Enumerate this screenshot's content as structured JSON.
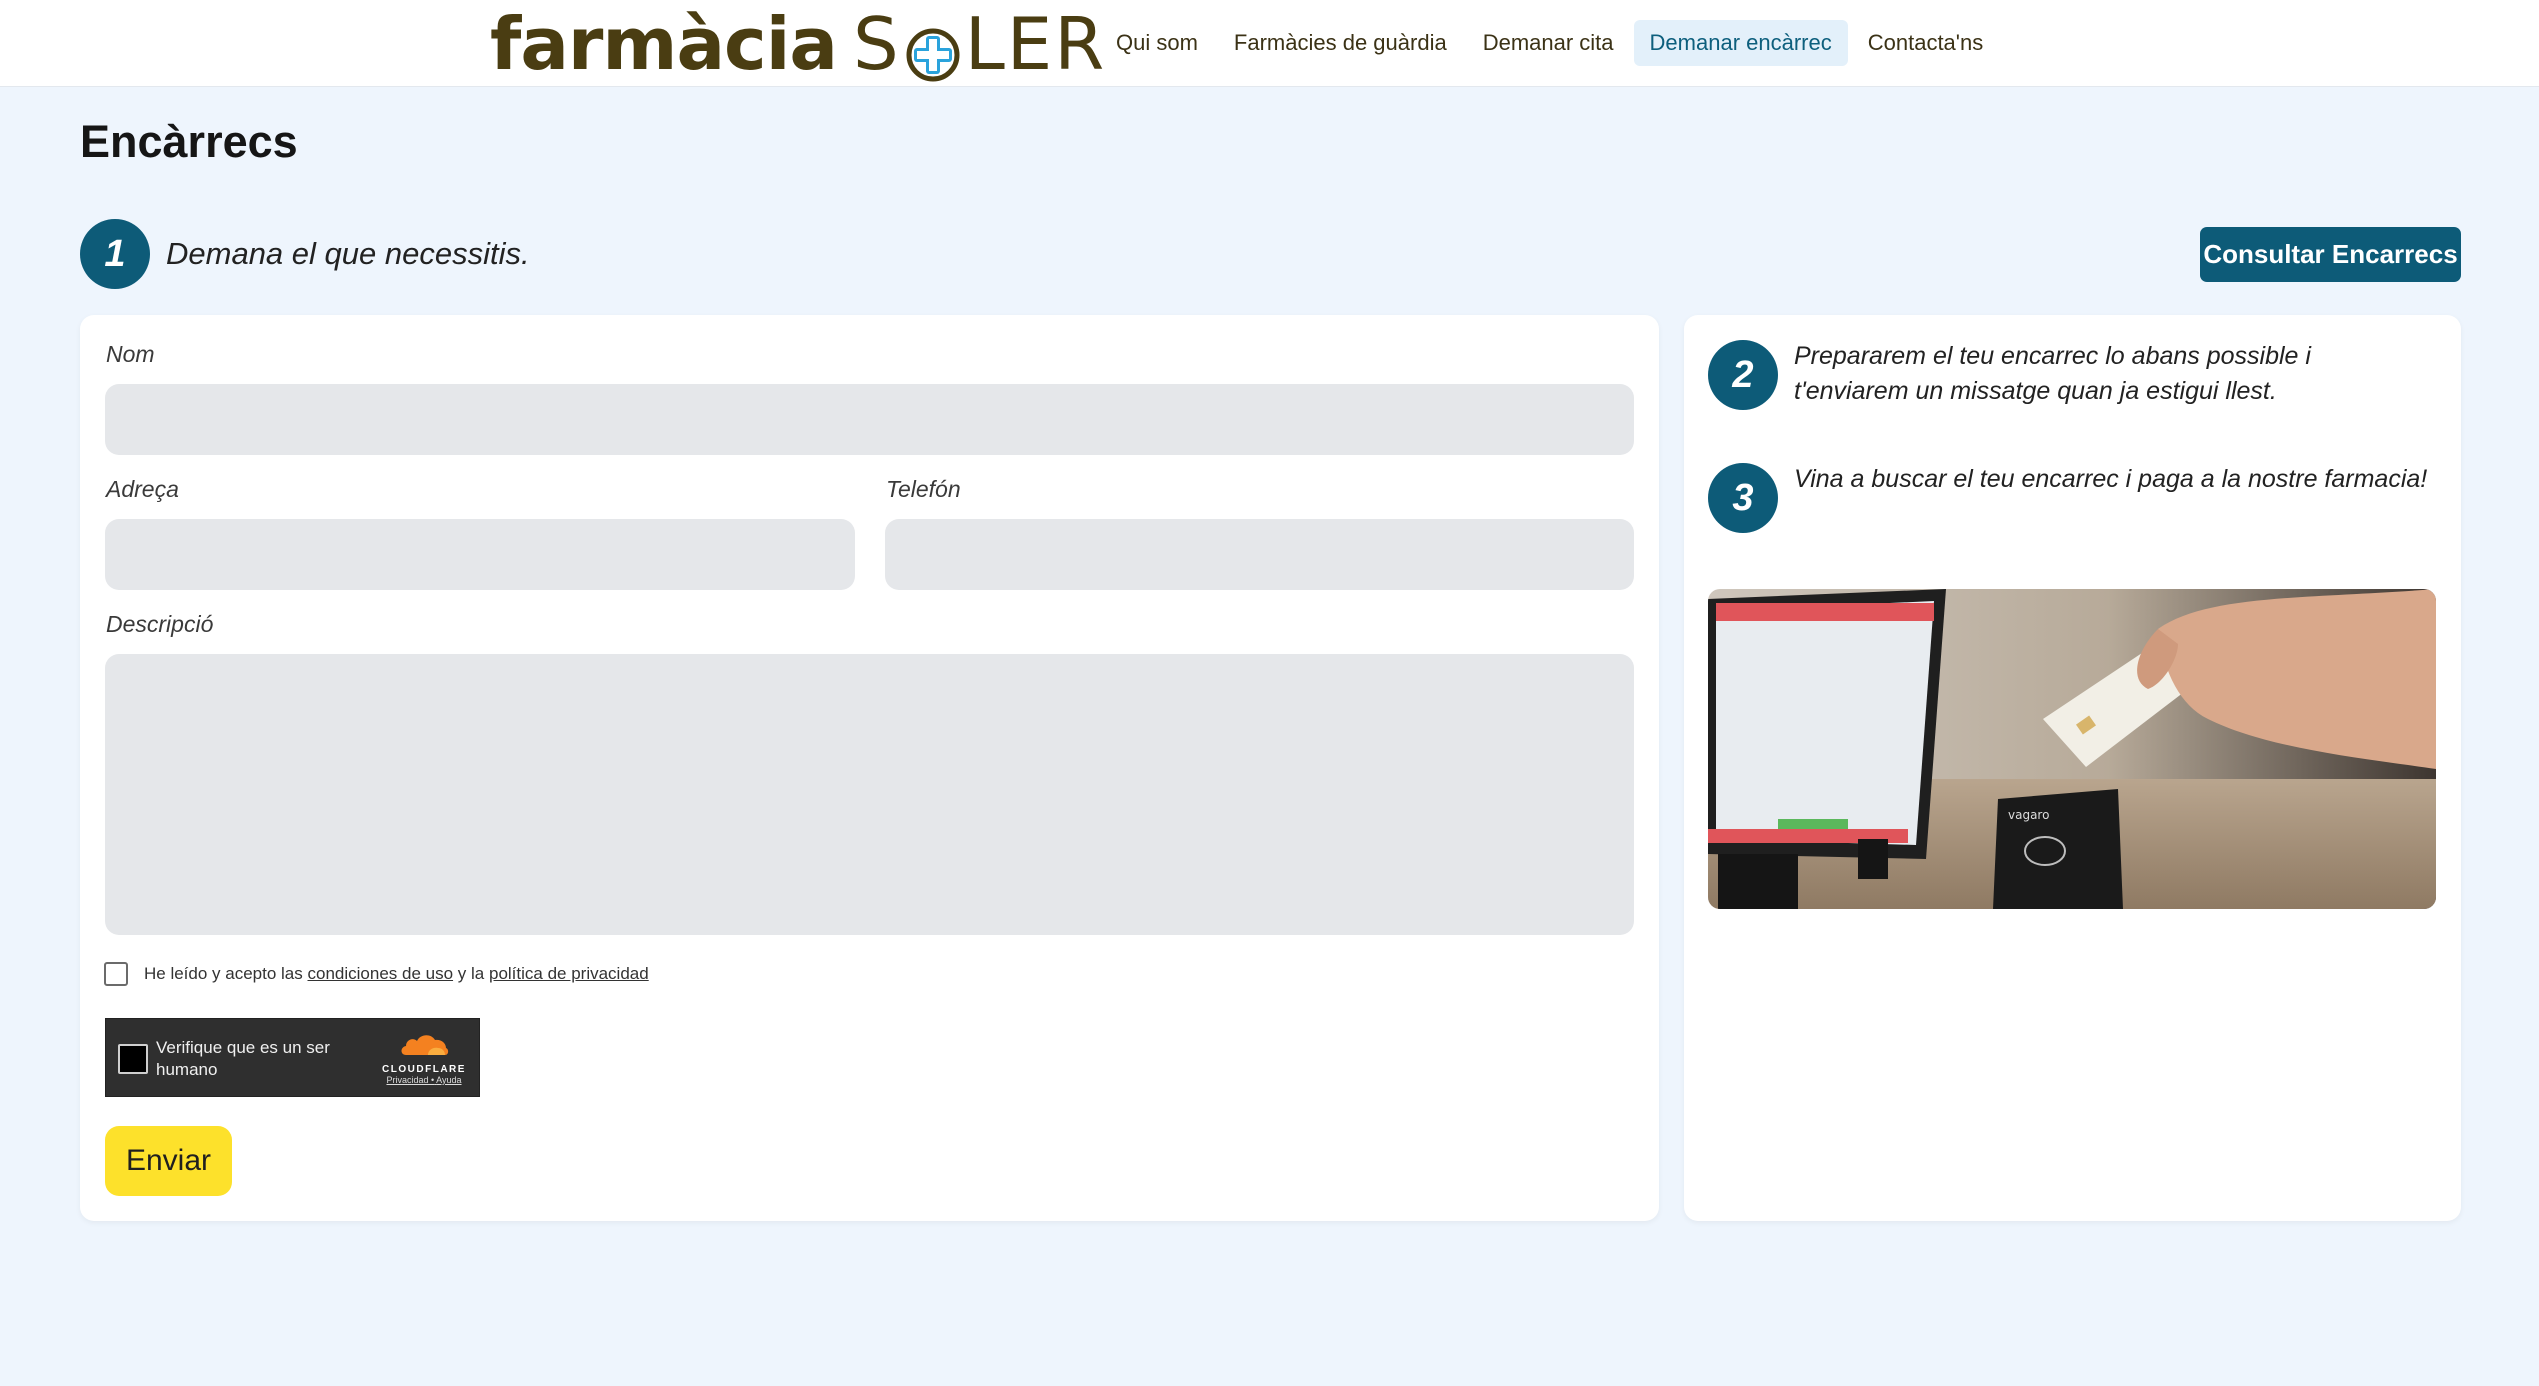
{
  "brand": {
    "name_bold": "farmàcia",
    "name_light_start": "S",
    "name_light_end": "LER",
    "accent_color": "#0d5b78",
    "logo_color": "#4a3d12",
    "cross_color": "#2aa3dc"
  },
  "nav": {
    "items": [
      {
        "label": "Qui som"
      },
      {
        "label": "Farmàcies de guàrdia"
      },
      {
        "label": "Demanar cita"
      },
      {
        "label": "Demanar encàrrec",
        "active": true
      },
      {
        "label": "Contacta'ns"
      }
    ]
  },
  "page": {
    "title": "Encàrrecs",
    "consult_button": "Consultar Encarrecs"
  },
  "steps": [
    {
      "number": "1",
      "text": "Demana el que necessitis."
    },
    {
      "number": "2",
      "text_line1": "Prepararem el teu encarrec lo abans possible i",
      "text_line2": "t'enviarem un missatge quan ja estigui llest."
    },
    {
      "number": "3",
      "text": "Vina a buscar el teu encarrec i paga a la nostre farmacia!"
    }
  ],
  "form": {
    "name_label": "Nom",
    "name_value": "",
    "address_label": "Adreça",
    "address_value": "",
    "phone_label": "Telefón",
    "phone_value": "",
    "description_label": "Descripció",
    "description_value": "",
    "terms_prefix": "He leído y acepto las",
    "terms_link1": "condiciones de uso",
    "terms_mid": "y la",
    "terms_link2": "política de privacidad",
    "terms_checked": false,
    "submit_label": "Enviar",
    "submit_color": "#fde12b"
  },
  "captcha": {
    "label": "Verifique que es un ser humano",
    "provider": "CLOUDFLARE",
    "link1": "Privacidad",
    "separator": "•",
    "link2": "Ayuda"
  },
  "photo": {
    "terminal_brand": "vagaro"
  }
}
